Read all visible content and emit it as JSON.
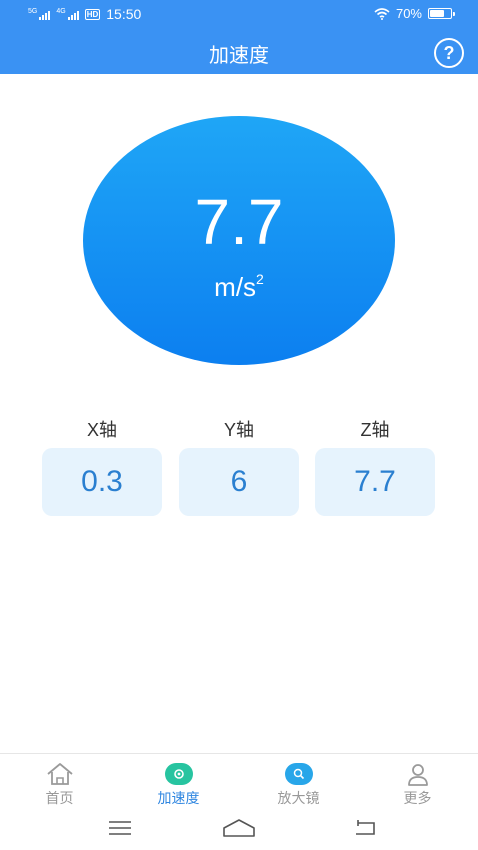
{
  "status_bar": {
    "net1": "5G",
    "net2": "4G",
    "hd": "HD",
    "time": "15:50",
    "battery": "70%",
    "battery_level": 0.7
  },
  "header": {
    "title": "加速度",
    "help_label": "?"
  },
  "reading": {
    "value": "7.7",
    "unit": "m/s",
    "unit_exp": "2"
  },
  "axes": [
    {
      "label": "X轴",
      "value": "0.3"
    },
    {
      "label": "Y轴",
      "value": "6"
    },
    {
      "label": "Z轴",
      "value": "7.7"
    }
  ],
  "bottom_nav": [
    {
      "label": "首页",
      "icon": "home-icon",
      "active": false
    },
    {
      "label": "加速度",
      "icon": "accel-icon",
      "active": true
    },
    {
      "label": "放大镜",
      "icon": "magnifier-icon",
      "active": false
    },
    {
      "label": "更多",
      "icon": "user-icon",
      "active": false
    }
  ],
  "colors": {
    "primary": "#3a92f3",
    "circle": "#0c7ff0",
    "axis_box": "#e6f3fd",
    "axis_text": "#2a7fd0",
    "nav_active": "#2f86e0"
  }
}
